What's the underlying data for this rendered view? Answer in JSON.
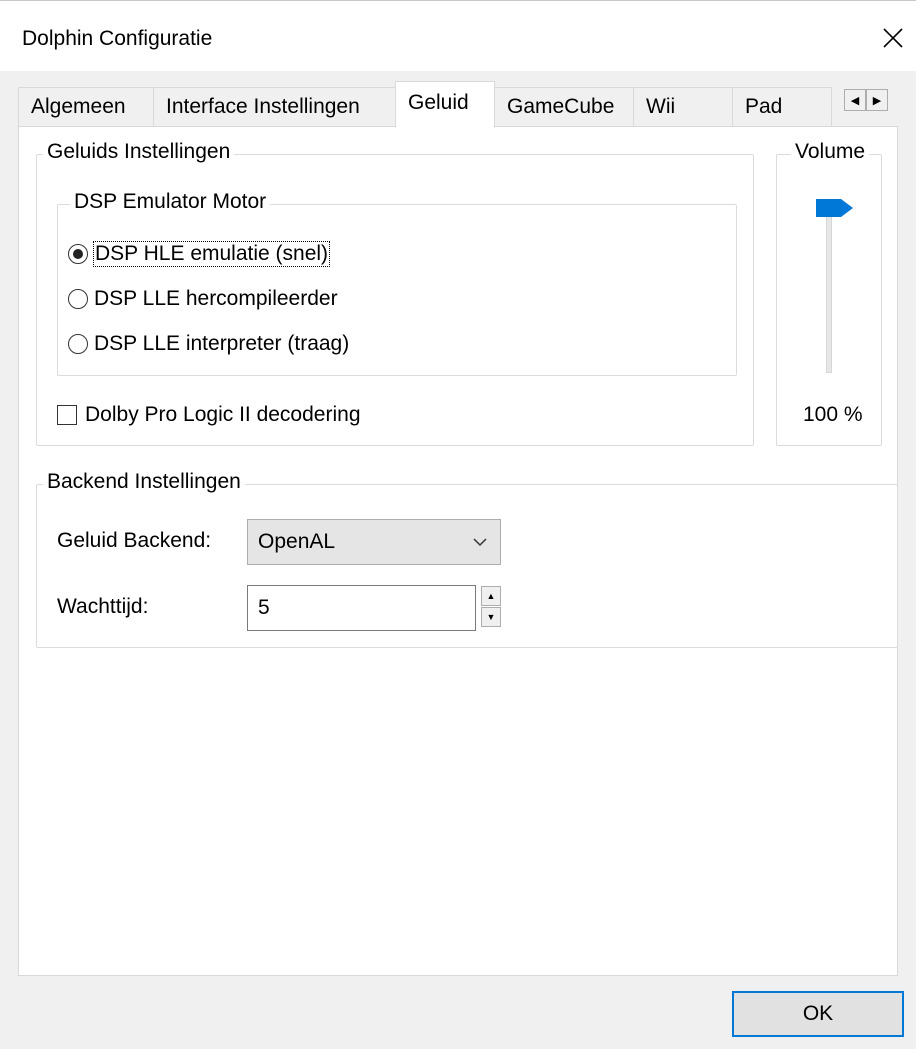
{
  "window": {
    "title": "Dolphin Configuratie"
  },
  "tabs": [
    {
      "label": "Algemeen"
    },
    {
      "label": "Interface Instellingen"
    },
    {
      "label": "Geluid",
      "active": true
    },
    {
      "label": "GameCube"
    },
    {
      "label": "Wii"
    },
    {
      "label": "Pad"
    }
  ],
  "sound_settings": {
    "legend": "Geluids Instellingen",
    "dsp": {
      "legend": "DSP Emulator Motor",
      "options": [
        {
          "label": "DSP HLE emulatie (snel)",
          "selected": true
        },
        {
          "label": "DSP LLE hercompileerder",
          "selected": false
        },
        {
          "label": "DSP LLE interpreter (traag)",
          "selected": false
        }
      ]
    },
    "dolby": {
      "label": "Dolby Pro Logic II decodering",
      "checked": false
    }
  },
  "volume": {
    "legend": "Volume",
    "value_text": "100 %",
    "level": 1.0
  },
  "backend_settings": {
    "legend": "Backend Instellingen",
    "backend_label": "Geluid Backend:",
    "backend_value": "OpenAL",
    "latency_label": "Wachttijd:",
    "latency_value": "5"
  },
  "buttons": {
    "ok": "OK"
  },
  "colors": {
    "accent": "#0078d7"
  }
}
